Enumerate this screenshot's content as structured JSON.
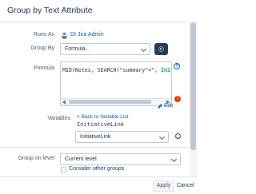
{
  "dialog": {
    "title": "Group by Text Attribute"
  },
  "runs_as": {
    "label": "Runs As",
    "user": "DI Jira Admin"
  },
  "group_by": {
    "label": "Group By",
    "value": "Formula..."
  },
  "formula": {
    "label": "Formula",
    "code_prefix": "MID(",
    "code_field": "Notes",
    "code_mid": ", SEARCH(\"summary\"=\", ",
    "code_var": "Initiative",
    "edit_label": "Edit"
  },
  "variables": {
    "label": "Variables",
    "back_link": "< Back to Variable List",
    "name": "InitiativeLink",
    "select_value": "InitiativeLink"
  },
  "group_on_level": {
    "label": "Group on level",
    "value": "Current level"
  },
  "consider_other_groups": {
    "label": "Consider other groups",
    "checked": false
  },
  "footer": {
    "apply_label": "Apply",
    "cancel_label": "Cancel"
  },
  "colors": {
    "link": "#0052cc",
    "primary_dark": "#253858",
    "error": "#de350b"
  }
}
